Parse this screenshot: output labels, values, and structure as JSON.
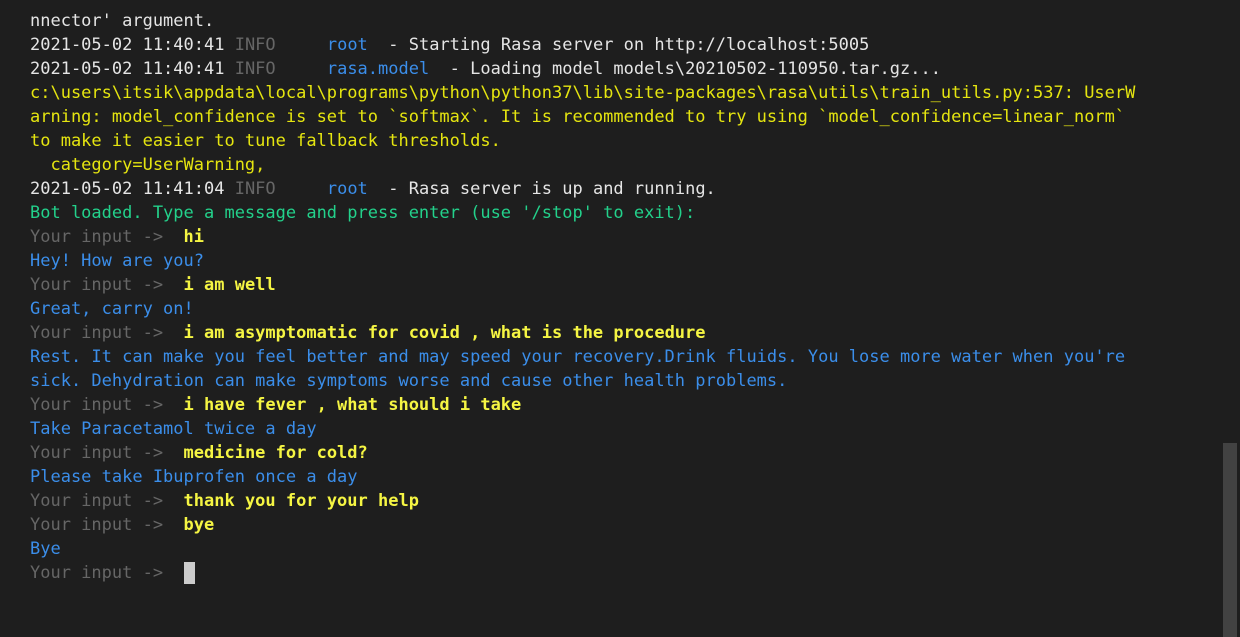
{
  "log": {
    "line0": "nnector' argument.",
    "line1": {
      "ts": "2021-05-02 11:40:41 ",
      "level": "INFO",
      "pad": "     ",
      "logger": "root",
      "msg": "  - Starting Rasa server on http://localhost:5005"
    },
    "line2": {
      "ts": "2021-05-02 11:40:41 ",
      "level": "INFO",
      "pad": "     ",
      "logger": "rasa.model",
      "msg": "  - Loading model models\\20210502-110950.tar.gz..."
    },
    "warning": [
      "c:\\users\\itsik\\appdata\\local\\programs\\python\\python37\\lib\\site-packages\\rasa\\utils\\train_utils.py:537: UserW",
      "arning: model_confidence is set to `softmax`. It is recommended to try using `model_confidence=linear_norm`",
      "to make it easier to tune fallback thresholds.",
      "  category=UserWarning,"
    ],
    "line3": {
      "ts": "2021-05-02 11:41:04 ",
      "level": "INFO",
      "pad": "     ",
      "logger": "root",
      "msg": "  - Rasa server is up and running."
    },
    "bot_loaded": "Bot loaded. Type a message and press enter (use '/stop' to exit):"
  },
  "prompt": "Your input ->  ",
  "conversation": {
    "u1": "hi",
    "b1": "Hey! How are you?",
    "u2": "i am well",
    "b2": "Great, carry on!",
    "u3": "i am asymptomatic for covid , what is the procedure",
    "b3a": "Rest. It can make you feel better and may speed your recovery.Drink fluids. You lose more water when you're",
    "b3b": "sick. Dehydration can make symptoms worse and cause other health problems.",
    "u4": "i have fever , what should i take",
    "b4": "Take Paracetamol twice a day",
    "u5": "medicine for cold?",
    "b5": "Please take Ibuprofen once a day",
    "u6": "thank you for your help",
    "u7": "bye",
    "b7": "Bye"
  },
  "colors": {
    "background": "#1e1e1e",
    "user_text": "#f5f543",
    "bot_text": "#3b8eea",
    "prompt": "#666666",
    "warning": "#e5e510",
    "success": "#23d18b"
  }
}
